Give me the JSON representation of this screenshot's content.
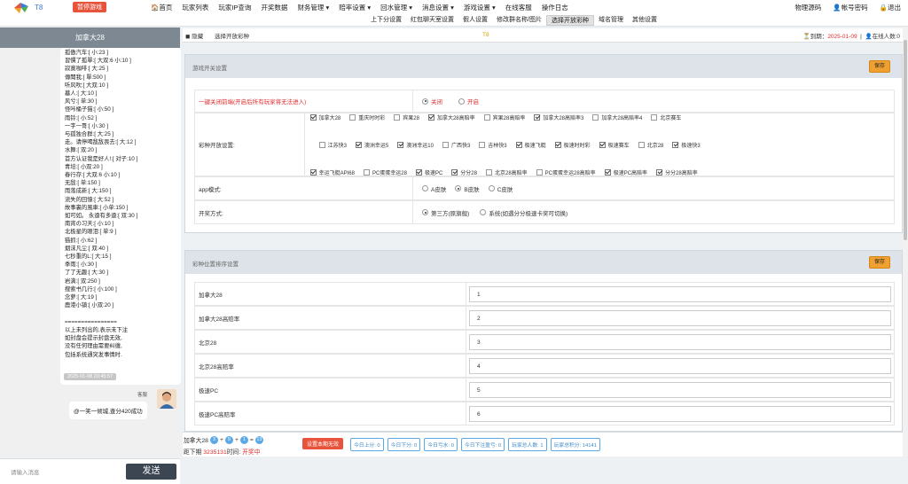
{
  "header": {
    "app_title": "T8",
    "stop_game": "暂停游戏",
    "nav": [
      "🏠首页",
      "玩家列表",
      "玩家IP查询",
      "开奖数据",
      "财务管理 ▾",
      "赔率设置 ▾",
      "回水管理 ▾",
      "消息设置 ▾",
      "游戏设置 ▾",
      "在线客服",
      "操作日志"
    ],
    "right": [
      "物理源码",
      "👤帐号密码",
      "🔒退出"
    ],
    "subnav": [
      "上下分设置",
      "红包聊天室设置",
      "假人设置",
      "修改群名称/图片",
      "选择开放彩种",
      "域名管理",
      "其他设置"
    ],
    "subnav_active": 4
  },
  "chat": {
    "title": "加拿大28",
    "bubble_lines": [
      "孤傲汽车:[ 小:23 ]",
      "習慣了孤單:[ 大双:6 小:10 ]",
      "寂寞咖啡:[ 大:25 ]",
      "傳聞我:[ 單:500 ]",
      "听风吹:[ 大双:10 ]",
      "墓人:[ 大:10 ]",
      "风兮:[ 单:30 ]",
      "怪咔桶子猫:[ 小:50 ]",
      "雨铃:[ 小:52 ]",
      "一字一哥:[ 小:30 ]",
      "与孤独合群:[ 大:25 ]",
      "走。请停喝敌敌畏去:[ 大:12 ]",
      "水舞:[ 双:20 ]",
      "首方认证我是好人!:[ 对子:10 ]",
      "青培:[ 小双:20 ]",
      "春行存:[ 大双:6 小:10 ]",
      "无敌:[ 单:150 ]",
      "雨落成新:[ 大:150 ]",
      "流失的回憶:[ 大:52 ]",
      "故事裏的風車:[ 小单:150 ]",
      "如可如。 永遠有多遠:[ 双:30 ]",
      "南宵の习天:[ 小:10 ]",
      "北极星的眼泪:[ 单:9 ]",
      "猫抓:[ 小:62 ]",
      "烟沫凡尘:[ 双:40 ]",
      "七秒重的L:[ 大:15 ]",
      "季雨:[ 小:30 ]",
      "了了无趣:[ 大:30 ]",
      "岩满:[ 双:250 ]",
      "搜索书几行:[ 小:100 ]",
      "念萝:[ 大:19 ]",
      "鹿港小镇:[ 小双:20 ]",
      "",
      "================",
      "以上未列出的,表示未下注",
      "如封盘会提示封盘无效,",
      "没有任何理由需要纠缠,",
      "包括系统通突发事情时."
    ],
    "timestamp": "2025-01-08 20:45:57",
    "sender": "客服",
    "message": "@一笑一倾城,查分420成功",
    "input_placeholder": "请输入消息",
    "send": "发送"
  },
  "tabbar": {
    "tab1": "◼ 隐藏",
    "tab2": "选择开放彩种",
    "center": "T8",
    "expire_label": "⏳到期：",
    "expire_date": "2025-01-09",
    "online": "👤在线人数:0"
  },
  "panel1": {
    "title": "游戏开关设置",
    "save": "保存",
    "row1_label": "一键关闭前端(开启后所有玩家将无法进入)",
    "row1_options": [
      "关闭",
      "开启"
    ],
    "row2_label": "彩种开放设置:",
    "games": [
      {
        "n": "加拿大28",
        "c": true
      },
      {
        "n": "重庆时时彩",
        "c": false
      },
      {
        "n": "宾果28",
        "c": false
      },
      {
        "n": "加拿大28高赔率",
        "c": true
      },
      {
        "n": "宾果28高赔率",
        "c": false
      },
      {
        "n": "加拿大28高赔率3",
        "c": true
      },
      {
        "n": "加拿大28高赔率4",
        "c": false
      },
      {
        "n": "北京赛车",
        "c": false
      },
      {
        "n": "江苏快3",
        "c": false
      },
      {
        "n": "澳洲幸运5",
        "c": true
      },
      {
        "n": "澳洲幸运10",
        "c": true
      },
      {
        "n": "广西快3",
        "c": false
      },
      {
        "n": "吉林快3",
        "c": false
      },
      {
        "n": "极速飞艇",
        "c": true
      },
      {
        "n": "极速时时彩",
        "c": true
      },
      {
        "n": "极速赛车",
        "c": true
      },
      {
        "n": "北京28",
        "c": false
      },
      {
        "n": "极速快3",
        "c": true
      },
      {
        "n": "幸运飞艇API68",
        "c": true
      },
      {
        "n": "PC蛋蛋幸运28",
        "c": false
      },
      {
        "n": "极速PC",
        "c": true
      },
      {
        "n": "分分28",
        "c": true
      },
      {
        "n": "北京28高赔率",
        "c": false
      },
      {
        "n": "PC蛋蛋幸运28高赔率",
        "c": false
      },
      {
        "n": "极速PC高赔率",
        "c": true
      },
      {
        "n": "分分28高赔率",
        "c": true
      }
    ],
    "row3_label": "app模式:",
    "row3_options": [
      "A皮肤",
      "B皮肤",
      "C皮肤"
    ],
    "row4_label": "开奖方式:",
    "row4_options": [
      "第三方(原旗舰)",
      "系统(如遇分分极速卡奖可切换)"
    ]
  },
  "panel2": {
    "title": "彩种位置排序设置",
    "save": "保存",
    "rows": [
      {
        "l": "加拿大28",
        "v": "1"
      },
      {
        "l": "加拿大28高赔率",
        "v": "2"
      },
      {
        "l": "北京28",
        "v": "3"
      },
      {
        "l": "北京28高赔率",
        "v": "4"
      },
      {
        "l": "极速PC",
        "v": "5"
      },
      {
        "l": "极速PC高赔率",
        "v": "6"
      }
    ]
  },
  "status": {
    "game": "加拿大28",
    "n1": "3",
    "n2": "9",
    "n3": "1",
    "sum": "13",
    "next_label": "距下期",
    "next_issue": "3235131",
    "time_label": "时间:",
    "time_value": "开奖中",
    "reset": "设置本期无效",
    "stats": [
      "今日上分: 0",
      "今日下分: 0",
      "今日亏水: 0",
      "今日下注盈亏: 0",
      "玩家总人数: 1",
      "玩家总积分: 14141"
    ]
  },
  "colors": {
    "accent": "#f0a030",
    "danger": "#e8533b",
    "link": "#3b88c8"
  }
}
